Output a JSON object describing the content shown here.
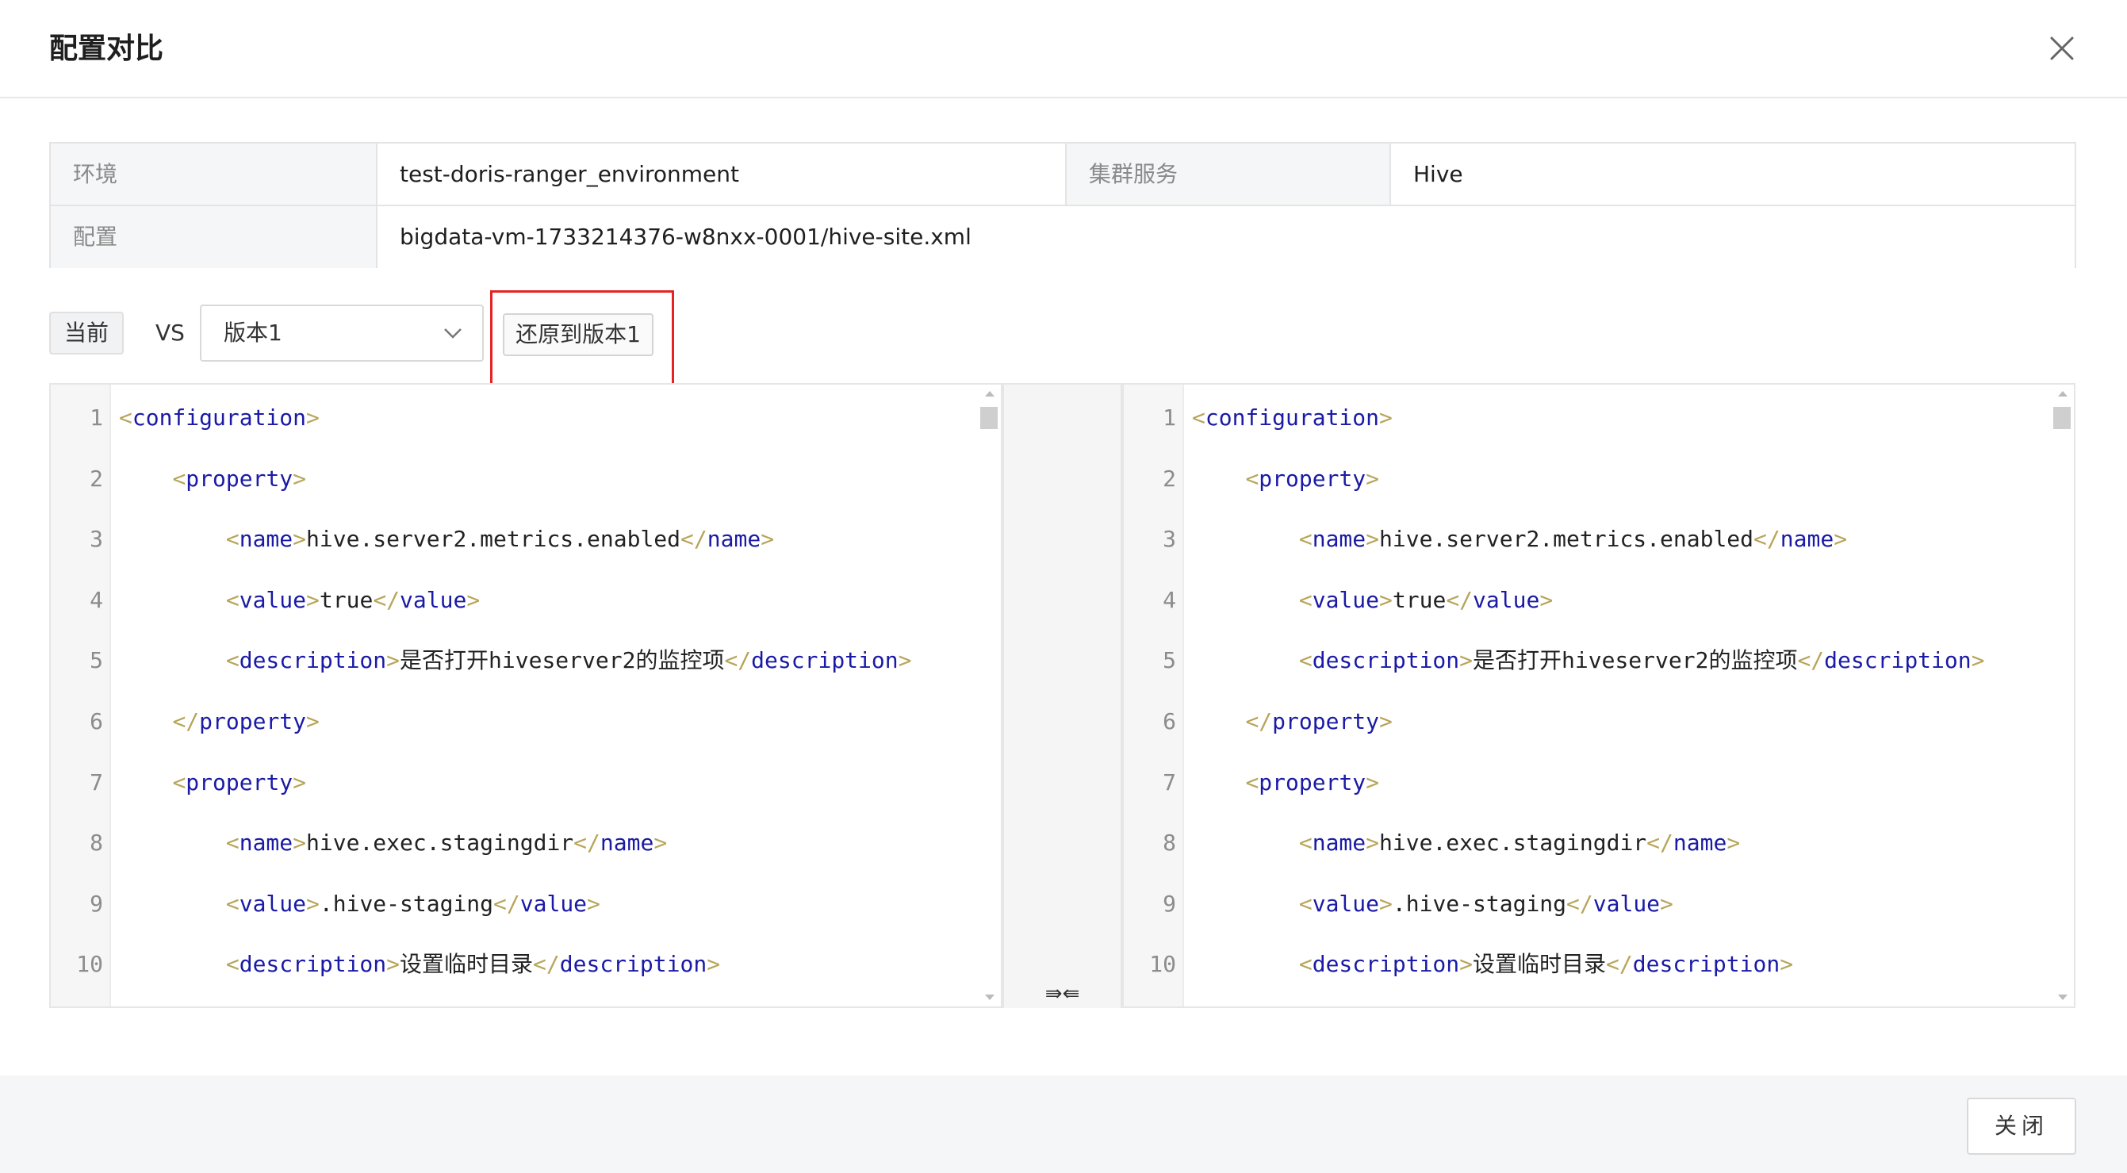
{
  "dialog": {
    "title": "配置对比",
    "close_icon": "close-icon"
  },
  "info": {
    "env_label": "环境",
    "env_value": "test-doris-ranger_environment",
    "service_label": "集群服务",
    "service_value": "Hive",
    "config_label": "配置",
    "config_value": "bigdata-vm-1733214376-w8nxx-0001/hive-site.xml"
  },
  "compare": {
    "current_label": "当前",
    "vs_label": "VS",
    "selected_version": "版本1",
    "restore_label": "还原到版本1",
    "merge_symbol": "⇛⇚"
  },
  "editor_left": {
    "lines": [
      {
        "n": "1",
        "code": "<configuration>"
      },
      {
        "n": "2",
        "code": "    <property>"
      },
      {
        "n": "3",
        "code": "        <name>hive.server2.metrics.enabled</name>"
      },
      {
        "n": "4",
        "code": "        <value>true</value>"
      },
      {
        "n": "5",
        "code": "        <description>是否打开hiveserver2的监控项</description>"
      },
      {
        "n": "6",
        "code": "    </property>"
      },
      {
        "n": "7",
        "code": "    <property>"
      },
      {
        "n": "8",
        "code": "        <name>hive.exec.stagingdir</name>"
      },
      {
        "n": "9",
        "code": "        <value>.hive-staging</value>"
      },
      {
        "n": "10",
        "code": "        <description>设置临时目录</description>"
      }
    ]
  },
  "editor_right": {
    "lines": [
      {
        "n": "1",
        "code": "<configuration>"
      },
      {
        "n": "2",
        "code": "    <property>"
      },
      {
        "n": "3",
        "code": "        <name>hive.server2.metrics.enabled</name>"
      },
      {
        "n": "4",
        "code": "        <value>true</value>"
      },
      {
        "n": "5",
        "code": "        <description>是否打开hiveserver2的监控项</description>"
      },
      {
        "n": "6",
        "code": "    </property>"
      },
      {
        "n": "7",
        "code": "    <property>"
      },
      {
        "n": "8",
        "code": "        <name>hive.exec.stagingdir</name>"
      },
      {
        "n": "9",
        "code": "        <value>.hive-staging</value>"
      },
      {
        "n": "10",
        "code": "        <description>设置临时目录</description>"
      }
    ]
  },
  "footer": {
    "close_label": "关闭"
  },
  "colors": {
    "highlight": "#e52323",
    "tag": "#1a1aa6",
    "bracket": "#b8a55a"
  }
}
